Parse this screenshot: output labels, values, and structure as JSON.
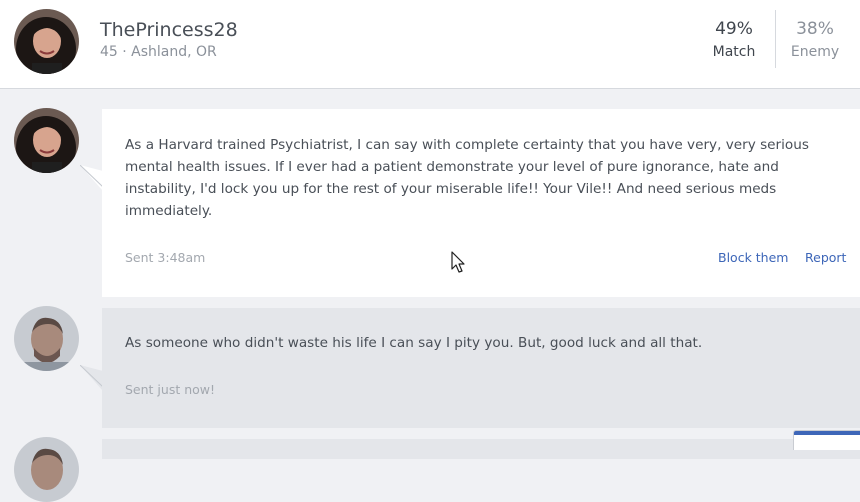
{
  "profile": {
    "username": "ThePrincess28",
    "info": "45 · Ashland, OR"
  },
  "stats": {
    "match_value": "49%",
    "match_label": "Match",
    "enemy_value": "38%",
    "enemy_label": "Enemy"
  },
  "messages": [
    {
      "text": "As a Harvard trained Psychiatrist, I can say with complete certainty that you have very, very serious mental health issues. If I ever had a patient demonstrate your level of pure ignorance, hate and instability, I'd lock you up for the rest of your miserable life!! Your Vile!! And need serious meds immediately.",
      "sent": "Sent 3:48am",
      "block_label": "Block them",
      "report_label": "Report"
    },
    {
      "text": "As someone who didn't waste his life I can say I pity you. But, good luck and all that.",
      "sent": "Sent just now!"
    }
  ],
  "colors": {
    "link": "#3d66b8",
    "page_bg": "#f0f1f4",
    "received_bg": "#ffffff",
    "sent_bg": "#e4e6ea"
  },
  "icons": {
    "cursor": "mouse-pointer-icon"
  }
}
